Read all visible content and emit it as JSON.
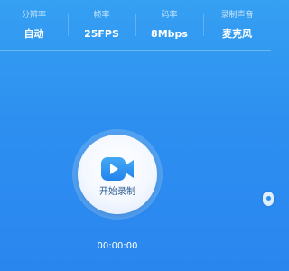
{
  "settings": [
    {
      "label": "分辨率",
      "value": "自动"
    },
    {
      "label": "帧率",
      "value": "25FPS"
    },
    {
      "label": "码率",
      "value": "8Mbps"
    },
    {
      "label": "录制声音",
      "value": "麦克风"
    }
  ],
  "record": {
    "label": "开始录制",
    "icon": "video-camera-icon"
  },
  "timer": "00:00:00",
  "colors": {
    "background": "#2d8ff0",
    "accent": "#2f90f1",
    "button_text": "#2c5a8f",
    "text_light": "#ffffff"
  }
}
